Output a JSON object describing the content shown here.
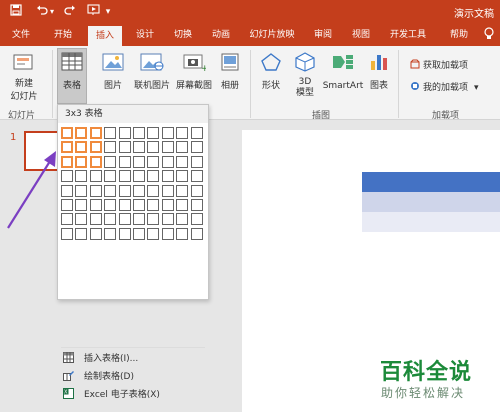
{
  "window": {
    "title": "演示文稿",
    "bar_color": "#c43e1c"
  },
  "quick_access": {
    "save_icon": "save-icon",
    "undo_icon": "undo-icon",
    "redo_icon": "redo-icon",
    "start_icon": "start-from-beginning-icon"
  },
  "tabs": [
    {
      "label": "文件"
    },
    {
      "label": "开始"
    },
    {
      "label": "插入",
      "active": true
    },
    {
      "label": "设计"
    },
    {
      "label": "切换"
    },
    {
      "label": "动画"
    },
    {
      "label": "幻灯片放映"
    },
    {
      "label": "审阅"
    },
    {
      "label": "视图"
    },
    {
      "label": "开发工具"
    },
    {
      "label": "帮助"
    }
  ],
  "ribbon": {
    "new_slide_line1": "新建",
    "new_slide_line2": "幻灯片",
    "table": "表格",
    "picture": "图片",
    "online_picture": "联机图片",
    "screenshot": "屏幕截图",
    "album": "相册",
    "shapes": "形状",
    "model3d_line1": "3D",
    "model3d_line2": "模型",
    "smartart": "SmartArt",
    "chart": "图表",
    "get_addins": "获取加载项",
    "my_addins": "我的加载项",
    "group_slides": "幻灯片",
    "group_illustrations": "插图",
    "group_addins": "加载项"
  },
  "dropdown": {
    "header": "3x3 表格",
    "rows": 8,
    "cols": 10,
    "highlight_rows": 3,
    "highlight_cols": 3,
    "highlight_color": "#f08a3c",
    "items": [
      {
        "label": "插入表格(I)..."
      },
      {
        "label": "绘制表格(D)"
      },
      {
        "label": "Excel 电子表格(X)"
      }
    ]
  },
  "slide_panel": {
    "number": "1"
  },
  "slide_table": {
    "header_color": "#4472c4",
    "row1_color": "#cfd5ea",
    "row2_color": "#e9ebf5"
  },
  "annotation": {
    "arrow_color": "#7b3fc2"
  },
  "watermark": {
    "main": "百科全说",
    "sub": "助你轻松解决"
  }
}
